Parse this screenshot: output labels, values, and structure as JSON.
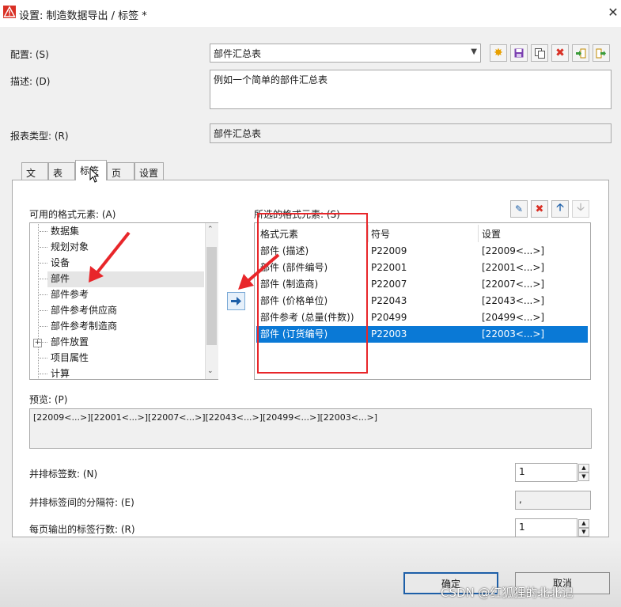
{
  "window": {
    "title": "设置: 制造数据导出 / 标签 *",
    "close_glyph": "✕"
  },
  "config": {
    "label": "配置: (S)",
    "value": "部件汇总表"
  },
  "description": {
    "label": "描述: (D)",
    "value": "例如一个简单的部件汇总表"
  },
  "report_type": {
    "label": "报表类型: (R)",
    "value": "部件汇总表"
  },
  "toolbar_icons": [
    "new-icon",
    "save-icon",
    "copy-icon",
    "delete-icon",
    "import-icon",
    "export-icon"
  ],
  "tabs": [
    {
      "label": "文件"
    },
    {
      "label": "表头"
    },
    {
      "label": "标签"
    },
    {
      "label": "页脚"
    },
    {
      "label": "设置"
    }
  ],
  "available": {
    "label": "可用的格式元素: (A)",
    "items": [
      "数据集",
      "规划对象",
      "设备",
      "部件",
      "部件参考",
      "部件参考供应商",
      "部件参考制造商",
      "部件放置",
      "项目属性",
      "计算"
    ],
    "expand_glyph": "+"
  },
  "selected": {
    "label": "所选的格式元素: (S)",
    "columns": [
      "格式元素",
      "符号",
      "设置"
    ],
    "rows": [
      {
        "element": "部件 (描述)",
        "symbol": "P22009",
        "setting": "[22009<...>]"
      },
      {
        "element": "部件 (部件编号)",
        "symbol": "P22001",
        "setting": "[22001<...>]"
      },
      {
        "element": "部件 (制造商)",
        "symbol": "P22007",
        "setting": "[22007<...>]"
      },
      {
        "element": "部件 (价格单位)",
        "symbol": "P22043",
        "setting": "[22043<...>]"
      },
      {
        "element": "部件参考 (总量(件数))",
        "symbol": "P20499",
        "setting": "[20499<...>]"
      },
      {
        "element": "部件 (订货编号)",
        "symbol": "P22003",
        "setting": "[22003<...>]"
      }
    ]
  },
  "preview": {
    "label": "预览: (P)",
    "value": "[22009<...>][22001<...>][22007<...>][22043<...>][20499<...>][22003<...>]"
  },
  "side_by_side": {
    "label": "并排标签数: (N)",
    "value": "1"
  },
  "separator": {
    "label": "并排标签间的分隔符: (E)",
    "value": ","
  },
  "rows_per_page": {
    "label": "每页输出的标签行数: (R)",
    "value": "1"
  },
  "buttons": {
    "ok": "确定",
    "cancel": "取消"
  },
  "watermark": "CSDN @红狐狸的北北记",
  "colors": {
    "selection": "#0a79d6",
    "annotation": "#e8262a",
    "accent_icon": "#d93025"
  }
}
